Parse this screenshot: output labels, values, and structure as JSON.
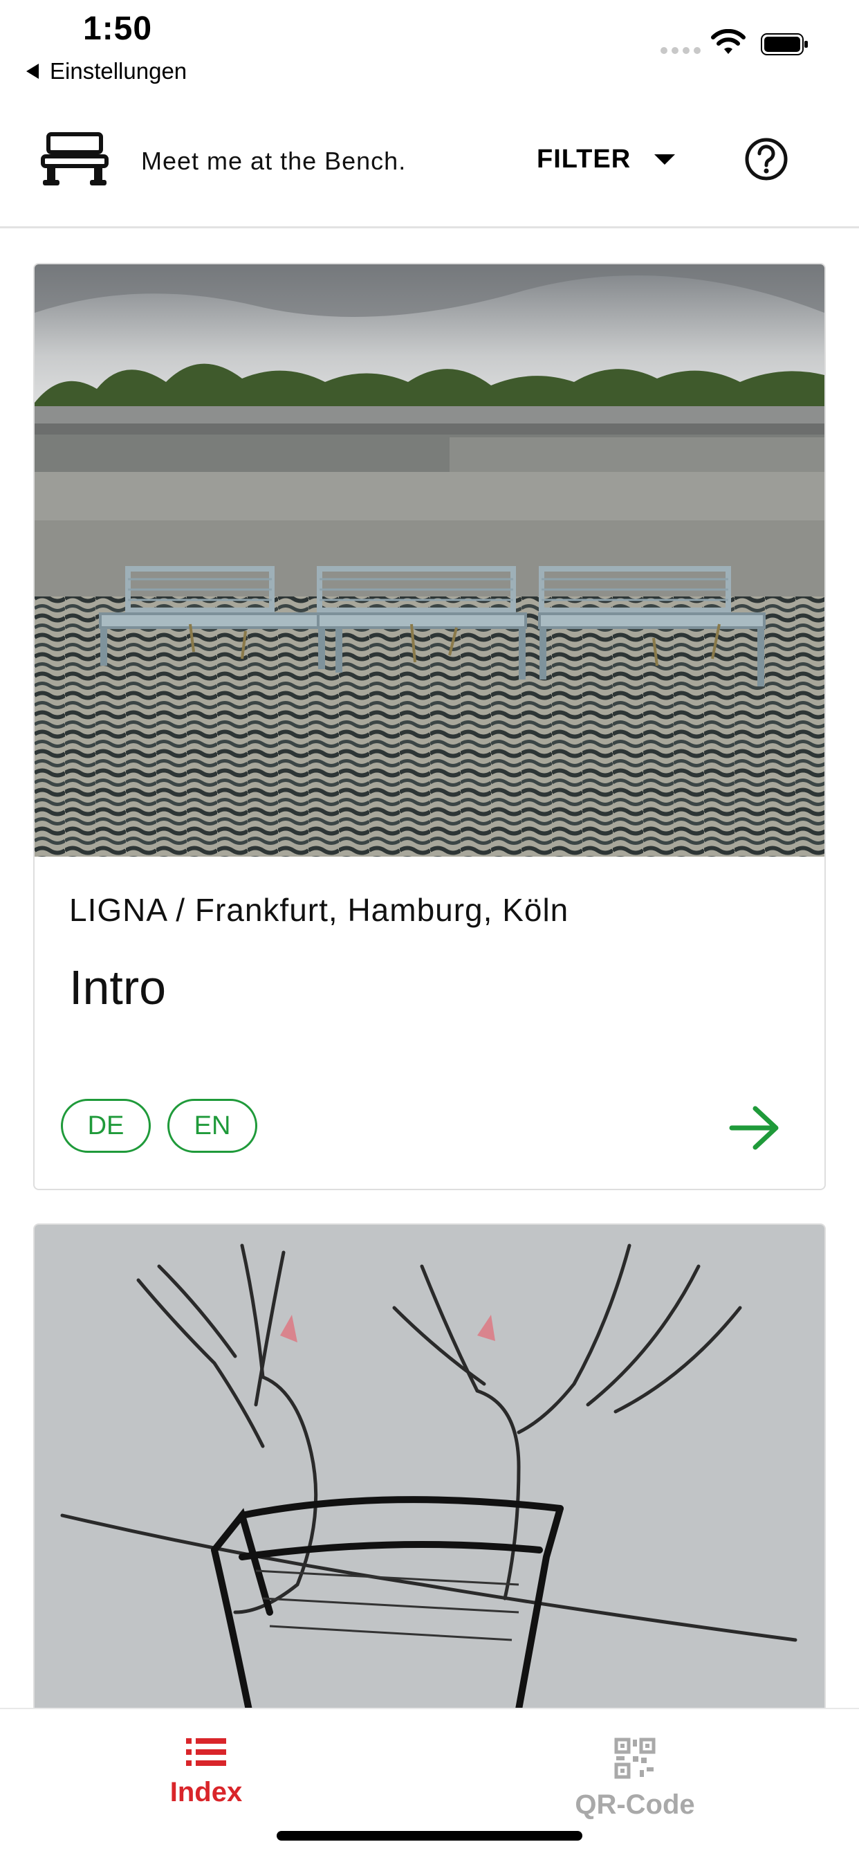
{
  "status_bar": {
    "time": "1:50",
    "back_label": "Einstellungen",
    "icons": [
      "signal-dots-icon",
      "wifi-icon",
      "battery-icon"
    ]
  },
  "header": {
    "app_title": "Meet me at the Bench.",
    "filter_label": "FILTER",
    "icons": [
      "bench-logo-icon",
      "help-circle-icon",
      "caret-down-icon"
    ]
  },
  "cards": [
    {
      "image": "photo of three metal benches on a paved lot",
      "subtitle": "LIGNA / Frankfurt, Hamburg, Köln",
      "title": "Intro",
      "languages": [
        "DE",
        "EN"
      ]
    },
    {
      "image": "pencil drawing of two winged creatures on a bench"
    }
  ],
  "tab_bar": {
    "tabs": [
      {
        "label": "Index",
        "active": true,
        "icon": "list-icon"
      },
      {
        "label": "QR-Code",
        "active": false,
        "icon": "qr-code-icon"
      }
    ]
  },
  "colors": {
    "accent_green": "#1f9a3a",
    "active_tab_red": "#d9252a",
    "inactive_tab_gray": "#a9a9a9"
  }
}
